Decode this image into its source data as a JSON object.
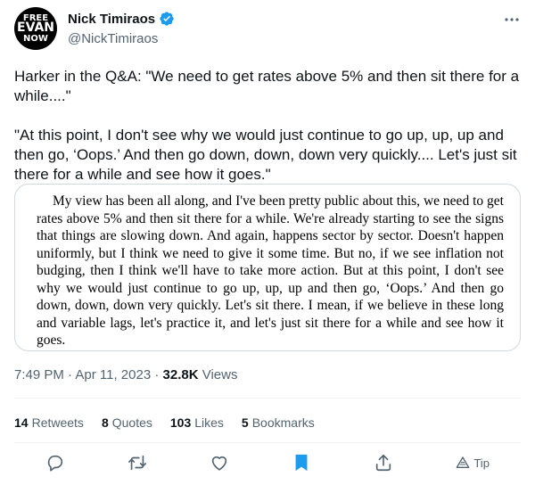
{
  "author": {
    "avatar_lines": [
      "FREE",
      "EVAN",
      "NOW"
    ],
    "name": "Nick Timiraos",
    "handle": "@NickTimiraos"
  },
  "tweet": {
    "text": "Harker in the Q&A: \"We need to get rates above 5% and then sit there for a while....\"\n\n\"At this point, I don't see why we would just continue to go up, up, up and then go, ‘Oops.’ And then go down, down, down very quickly.... Let's just sit there for a while and see how it goes.\""
  },
  "media": {
    "quote": "My view has been all along, and I've been pretty public about this, we need to get rates above 5% and then sit there for a while. We're already starting to see the signs that things are slowing down. And again, happens sector by sector. Doesn't happen uniformly, but I think we need to give it some time. But no, if we see inflation not budging, then I think we'll have to take more action. But at this point, I don't see why we would just continue to go up, up, up and then go, ‘Oops.’ And then go down, down, down very quickly. Let's sit there. I mean, if we believe in these long and variable lags, let's practice it, and let's just sit there for a while and see how it goes."
  },
  "meta": {
    "time": "7:49 PM",
    "sep1": " · ",
    "date": "Apr 11, 2023",
    "sep2": " · ",
    "views_count": "32.8K",
    "views_label": " Views"
  },
  "stats": {
    "retweets_count": "14",
    "retweets_label": "Retweets",
    "quotes_count": "8",
    "quotes_label": "Quotes",
    "likes_count": "103",
    "likes_label": "Likes",
    "bookmarks_count": "5",
    "bookmarks_label": "Bookmarks"
  },
  "actions": {
    "tip_label": "Tip"
  },
  "colors": {
    "accent": "#1d9bf0",
    "text": "#0f1419",
    "secondary": "#536471",
    "border": "#cfd9de"
  },
  "icons": [
    "verified-badge-icon",
    "more-icon",
    "reply-icon",
    "retweet-icon",
    "like-icon",
    "bookmark-icon",
    "share-icon",
    "tip-icon"
  ]
}
